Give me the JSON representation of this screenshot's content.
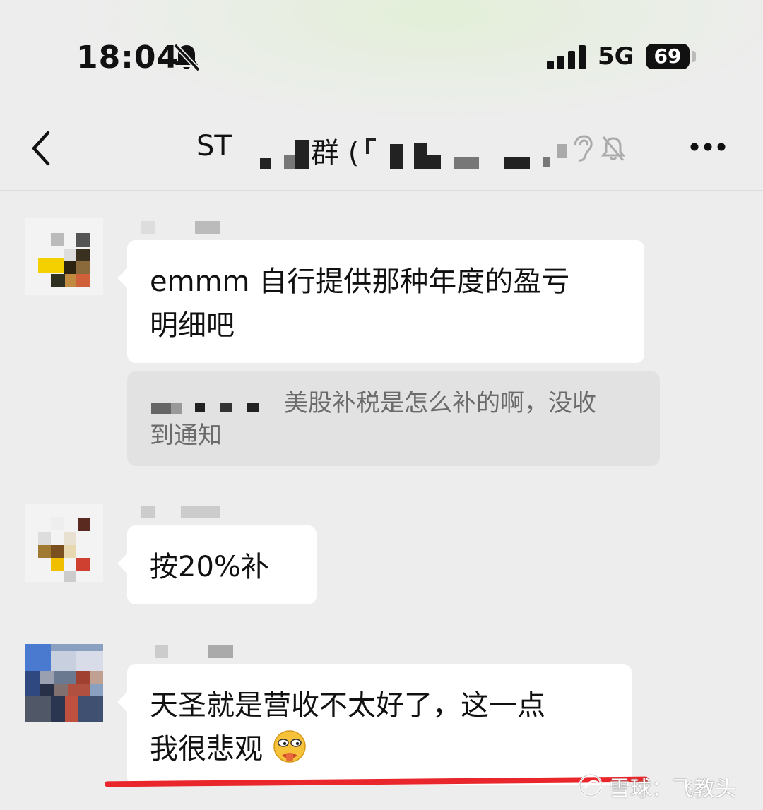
{
  "status_bar": {
    "time": "18:04",
    "network": "5G",
    "battery": "69"
  },
  "nav": {
    "title_prefix": "ST",
    "title_middle": "群 (",
    "icons": [
      "back-icon",
      "ear-icon",
      "bell-mute-icon",
      "more-icon"
    ]
  },
  "messages": [
    {
      "type": "text",
      "lines": [
        "emmm 自行提供那种年度的盈亏",
        "明细吧"
      ]
    },
    {
      "type": "quote",
      "text": "美股补税是怎么补的啊，没收",
      "text2": "到通知"
    },
    {
      "type": "text",
      "lines": [
        "按20%补"
      ]
    },
    {
      "type": "text",
      "lines": [
        "天圣就是营收不太好了，这一点",
        "我很悲观"
      ],
      "emoji": "sad-face-emoji"
    }
  ],
  "watermark": {
    "text": "雪球：飞教头"
  },
  "colors": {
    "background": "#ededed",
    "bubble": "#ffffff",
    "quote_bg": "#e2e2e2",
    "underline": "#e8262b"
  }
}
